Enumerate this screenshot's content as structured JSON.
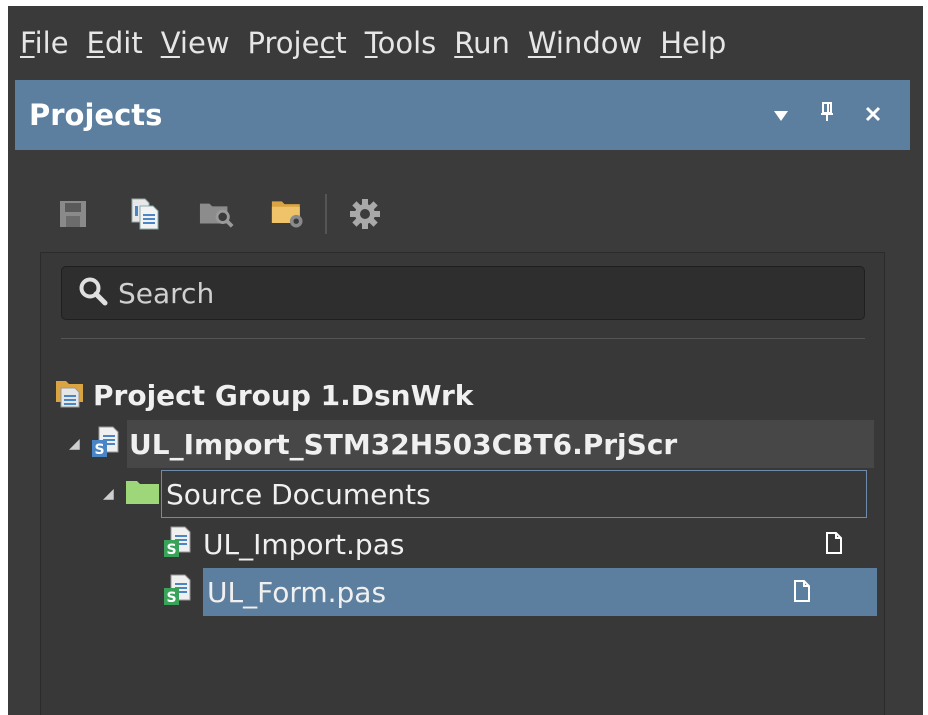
{
  "menu": [
    {
      "mnemonic": "F",
      "rest": "ile"
    },
    {
      "mnemonic": "E",
      "rest": "dit"
    },
    {
      "mnemonic": "V",
      "rest": "iew"
    },
    {
      "pre": "Proje",
      "mnemonic": "c",
      "rest": "t"
    },
    {
      "mnemonic": "T",
      "rest": "ools"
    },
    {
      "mnemonic": "R",
      "rest": "un"
    },
    {
      "mnemonic": "W",
      "rest": "indow"
    },
    {
      "mnemonic": "H",
      "rest": "elp"
    }
  ],
  "panel": {
    "title": "Projects",
    "controls": {
      "menu": "▼",
      "pin": "🖈",
      "close": "×"
    }
  },
  "toolbar": {
    "icons": [
      "save-icon",
      "copy-document-icon",
      "browse-folder-icon",
      "folder-settings-icon",
      "gear-icon"
    ]
  },
  "search": {
    "placeholder": "Search"
  },
  "tree": {
    "group": "Project Group 1.DsnWrk",
    "project": "UL_Import_STM32H503CBT6.PrjScr",
    "folder": "Source Documents",
    "files": [
      {
        "name": "UL_Import.pas",
        "selected": false
      },
      {
        "name": "UL_Form.pas",
        "selected": true
      }
    ]
  },
  "colors": {
    "accent": "#5c7f9f",
    "selection": "#5c7f9f",
    "background": "#3b3b3b",
    "folder_green": "#9ed67a"
  }
}
